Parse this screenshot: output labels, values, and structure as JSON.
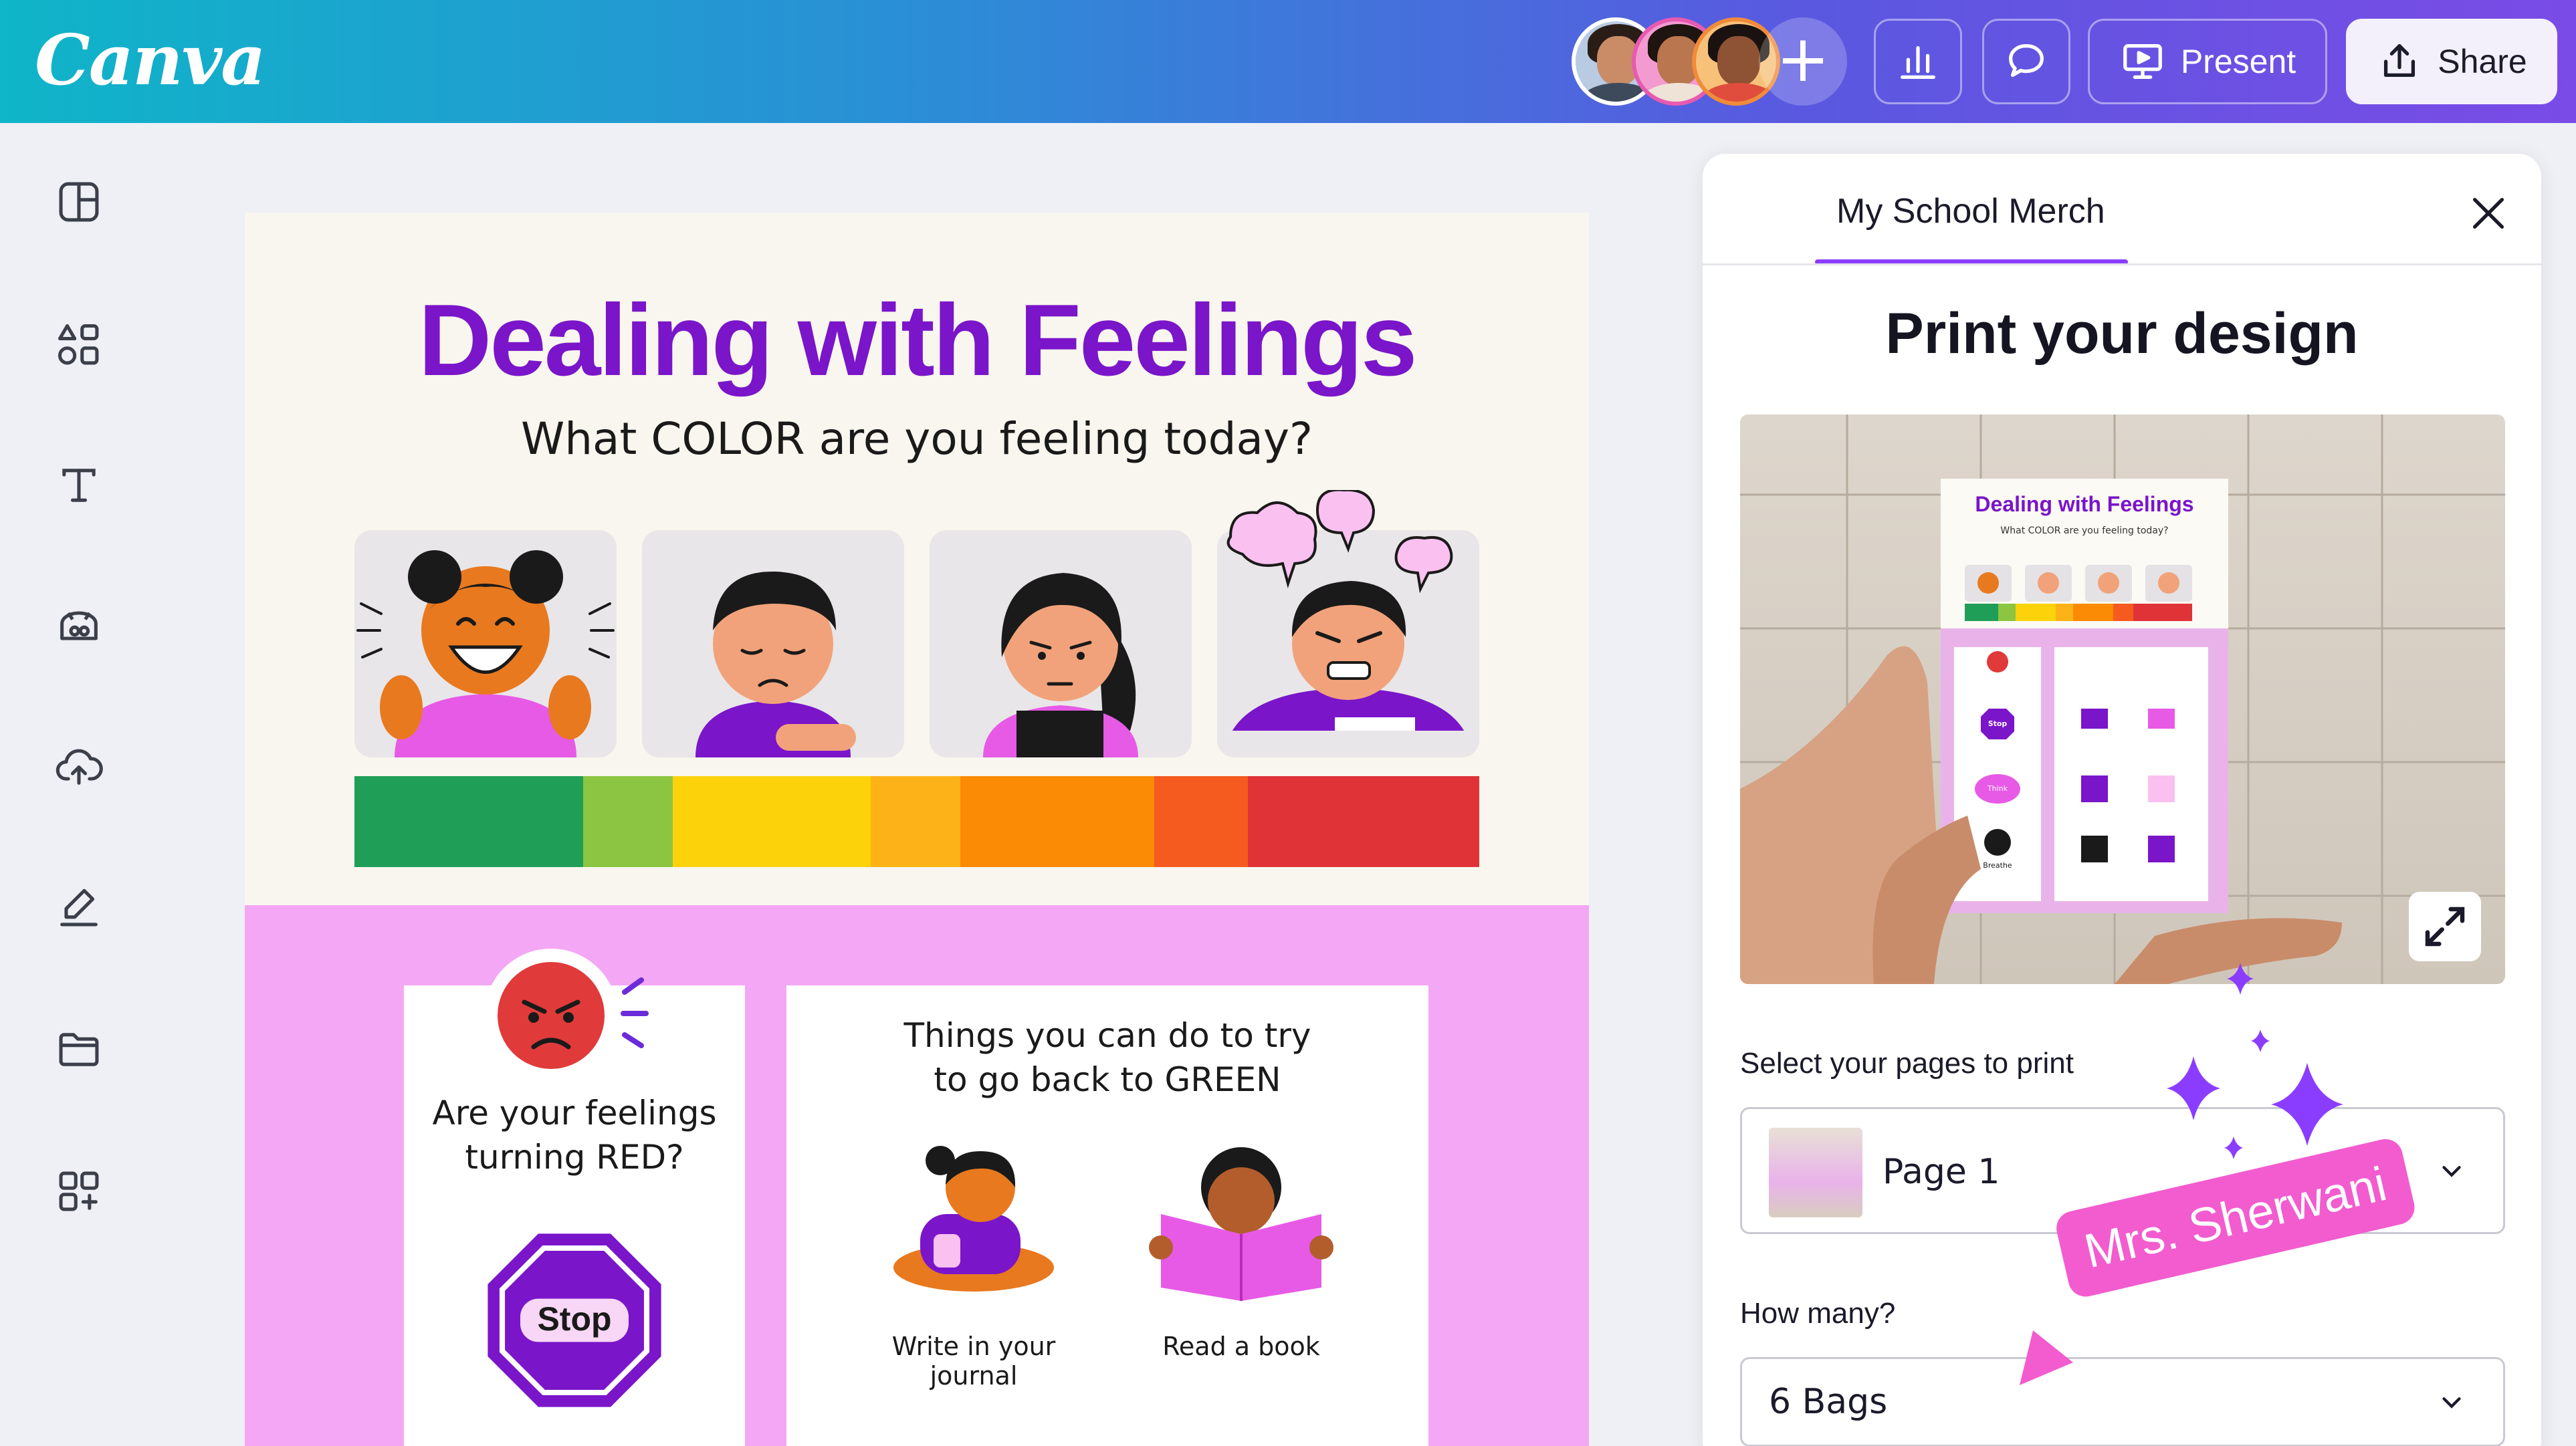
{
  "app": {
    "logo": "Canva"
  },
  "topbar": {
    "present_label": "Present",
    "share_label": "Share",
    "add_collaborator": "+"
  },
  "colors": {
    "accent": "#8b3dff",
    "title_purple": "#7a15c9",
    "design_pink": "#f4a7f4",
    "stop_purple": "#7a15c9",
    "angry_red": "#e03a3a",
    "colorbar": [
      "#1f9e57",
      "#8cc541",
      "#fcd20a",
      "#fdb317",
      "#fb8a05",
      "#f55a1f",
      "#e03338"
    ]
  },
  "design": {
    "title": "Dealing with Feelings",
    "subtitle": "What COLOR are you feeling today?",
    "red_card": {
      "question_line1": "Are your feelings",
      "question_line2": "turning RED?",
      "stop_label": "Stop"
    },
    "green_card": {
      "heading_line1": "Things you can do to try",
      "heading_line2": "to go back to GREEN",
      "activities": [
        "Write in your",
        "journal",
        "Read a book"
      ]
    }
  },
  "panel": {
    "tab_label": "My School Merch",
    "title": "Print your design",
    "preview": {
      "title": "Dealing with Feelings",
      "subtitle": "What COLOR are you feeling today?",
      "labels": [
        "Stop",
        "Think",
        "Breathe"
      ]
    },
    "pages_label": "Select your pages to print",
    "pages_value": "Page 1",
    "quantity_label": "How many?",
    "quantity_value": "6 Bags"
  },
  "cursor_tag": {
    "name": "Mrs. Sherwani"
  },
  "icons": {
    "rail": [
      "layout-icon",
      "elements-icon",
      "text-icon",
      "brand-icon",
      "uploads-icon",
      "draw-icon",
      "projects-icon",
      "apps-icon"
    ]
  }
}
